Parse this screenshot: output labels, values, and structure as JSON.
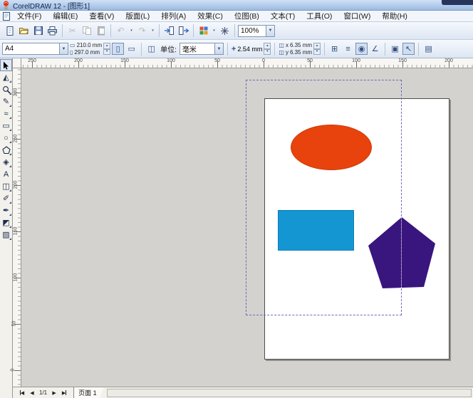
{
  "window": {
    "title": "CorelDRAW 12 - [图形1]"
  },
  "menu": [
    "文件(F)",
    "编辑(E)",
    "查看(V)",
    "版面(L)",
    "排列(A)",
    "效果(C)",
    "位图(B)",
    "文本(T)",
    "工具(O)",
    "窗口(W)",
    "帮助(H)"
  ],
  "toolbar": {
    "zoom_level": "100%"
  },
  "property_bar": {
    "paper_type": "A4",
    "paper_width": "210.0 mm",
    "paper_height": "297.0 mm",
    "units_label": "单位:",
    "units_value": "毫米",
    "nudge_offset": "2.54 mm",
    "duplicate_x": "6.35 mm",
    "duplicate_y": "6.35 mm",
    "dup_x_label": "x",
    "dup_y_label": "y"
  },
  "rulers": {
    "horizontal": [
      "250",
      "200",
      "150",
      "100",
      "50",
      "0",
      "50",
      "100",
      "150",
      "200"
    ],
    "vertical": [
      "300",
      "250",
      "200",
      "150",
      "100",
      "50",
      "0"
    ]
  },
  "toolbox": {
    "selected": "pick",
    "tools": [
      "pick",
      "shape",
      "zoom",
      "freehand",
      "smart-drawing",
      "rectangle",
      "ellipse",
      "polygon",
      "basic-shapes",
      "text",
      "interactive-blend",
      "eyedropper",
      "outline-pen",
      "fill",
      "interactive-fill"
    ]
  },
  "icons": {
    "cut": "✂",
    "undo": "↶",
    "redo": "↷",
    "shape-tool": "◭",
    "freehand-tool": "✎",
    "smart-drawing-tool": "≈",
    "rectangle-tool": "▭",
    "ellipse-tool": "○",
    "basic-shapes-tool": "◈",
    "text-tool": "A",
    "blend-tool": "◫",
    "eyedropper-tool": "✐",
    "outline-tool": "✒",
    "fill-tool": "◩",
    "interactive-fill-tool": "▨",
    "paper-width": "▭",
    "paper-height": "▯",
    "portrait": "▯",
    "landscape": "▭",
    "pages": "◫",
    "nudge": "+",
    "dup": "◫",
    "snap-grid": "⊞",
    "snap-guidelines": "≡",
    "snap-objects": "◉",
    "dynamic-guides": "∠",
    "treat-as-filled": "▣",
    "pick-state": "↖",
    "options": "▤",
    "dropdown": "▼",
    "dropdown-small": "▾",
    "stepper-up": "▴",
    "stepper-down": "▾",
    "nav-prev": "◀",
    "nav-next": "▶"
  },
  "canvas": {
    "shapes": {
      "ellipse_color": "#e8430d",
      "rectangle_color": "#1496d2",
      "pentagon_color": "#39157e",
      "marquee_dash_color": "#6b6bb8"
    }
  },
  "page_nav": {
    "indicator": "1/1",
    "tab": "页面 1"
  }
}
